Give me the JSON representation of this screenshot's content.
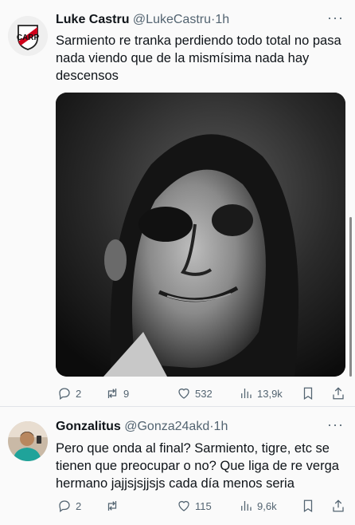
{
  "tweets": [
    {
      "display_name": "Luke Castru",
      "handle": "@LukeCastru",
      "separator": "·",
      "time": "1h",
      "more": "···",
      "text": "Sarmiento re tranka perdiendo todo total no pasa nada viendo que de la mismísima nada hay descensos",
      "has_media": true,
      "stats": {
        "replies": "2",
        "retweets": "9",
        "likes": "532",
        "views": "13,9k"
      }
    },
    {
      "display_name": "Gonzalitus",
      "handle": "@Gonza24akd",
      "separator": "·",
      "time": "1h",
      "more": "···",
      "text": "Pero que onda al final? Sarmiento, tigre, etc se tienen que preocupar o no? Que liga de re verga hermano jajjsjsjjsjs cada día menos seria",
      "has_media": false,
      "stats": {
        "replies": "2",
        "retweets": "",
        "likes": "115",
        "views": "9,6k"
      }
    }
  ],
  "icons": [
    "reply-icon",
    "retweet-icon",
    "like-icon",
    "views-icon",
    "bookmark-icon",
    "share-icon",
    "more-icon"
  ],
  "colors": {
    "text": "#0f1419",
    "secondary": "#536471",
    "background": "#fafafa",
    "river_red": "#d0021b"
  }
}
